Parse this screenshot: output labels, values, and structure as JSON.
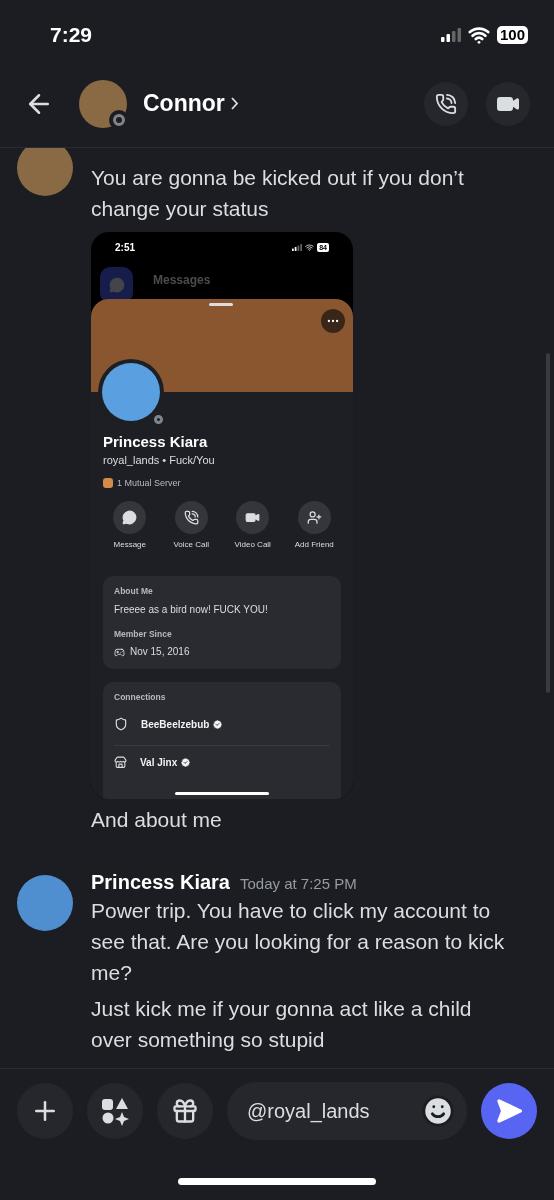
{
  "status_bar": {
    "time": "7:29",
    "battery": "100"
  },
  "header": {
    "name": "Connor",
    "online": false
  },
  "messages": [
    {
      "content": [
        {
          "kind": "text",
          "text": "You are gonna be kicked out if you don’t change your status"
        },
        {
          "kind": "screenshot",
          "status_bar": {
            "time": "2:51",
            "battery": "84"
          },
          "background_title": "Messages",
          "profile": {
            "display_name": "Princess Kiara",
            "username_line": "royal_lands • Fuck/You",
            "online": false,
            "mutual": "1 Mutual Server",
            "actions": [
              {
                "kind": "message",
                "label": "Message"
              },
              {
                "kind": "voice",
                "label": "Voice Call"
              },
              {
                "kind": "video",
                "label": "Video Call"
              },
              {
                "kind": "add_friend",
                "label": "Add Friend"
              }
            ],
            "about_heading": "About Me",
            "about": "Freeee as a bird now! FUCK YOU!",
            "member_heading": "Member Since",
            "member_since": "Nov 15, 2016",
            "connections_heading": "Connections",
            "connections": [
              {
                "kind": "shield",
                "name": "BeeBeelzebub",
                "verified": true
              },
              {
                "kind": "store",
                "name": "Val Jinx",
                "verified": true
              }
            ]
          }
        },
        {
          "kind": "text",
          "text": "And about me"
        }
      ]
    },
    {
      "author": "Princess Kiara",
      "timestamp": "Today at 7:25 PM",
      "content": [
        {
          "kind": "text",
          "text": "Power trip. You have to click my account to see that. Are you looking for a reason to kick me?"
        },
        {
          "kind": "text",
          "text": "Just kick me if your gonna act like a child over something so stupid"
        }
      ]
    }
  ],
  "composer": {
    "value": "@royal_lands"
  }
}
